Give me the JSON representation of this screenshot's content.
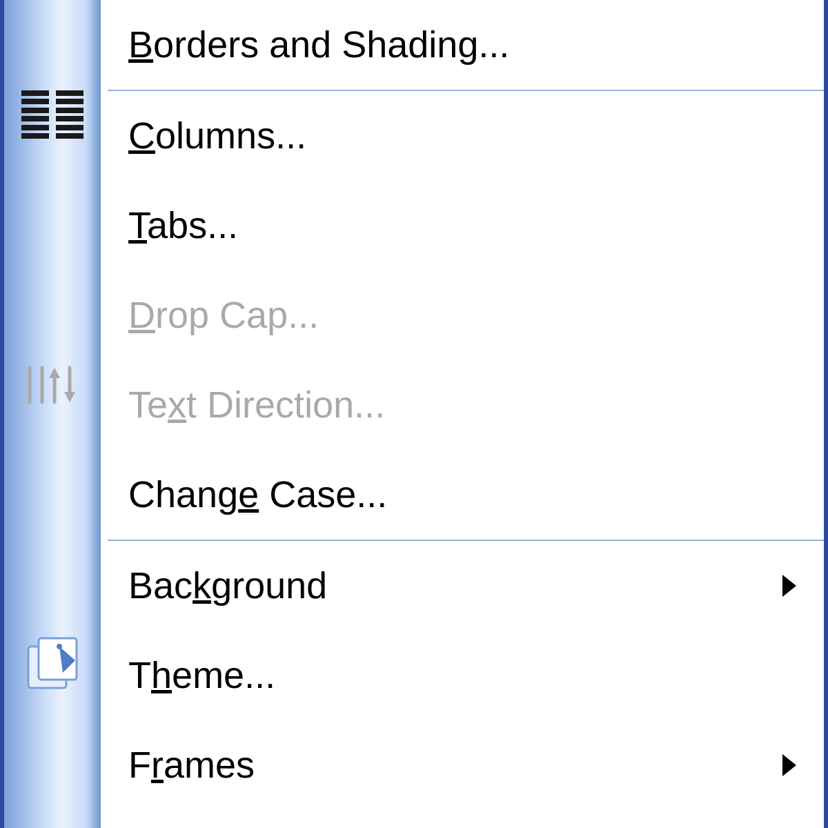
{
  "menu": {
    "items": [
      {
        "label_pre": "",
        "label_ul": "B",
        "label_post": "orders and Shading...",
        "disabled": false,
        "submenu": false,
        "icon": null,
        "sep_after": true
      },
      {
        "label_pre": "",
        "label_ul": "C",
        "label_post": "olumns...",
        "disabled": false,
        "submenu": false,
        "icon": "columns",
        "sep_after": false
      },
      {
        "label_pre": "",
        "label_ul": "T",
        "label_post": "abs...",
        "disabled": false,
        "submenu": false,
        "icon": null,
        "sep_after": false
      },
      {
        "label_pre": "",
        "label_ul": "D",
        "label_post": "rop Cap...",
        "disabled": true,
        "submenu": false,
        "icon": null,
        "sep_after": false
      },
      {
        "label_pre": "Te",
        "label_ul": "x",
        "label_post": "t Direction...",
        "disabled": true,
        "submenu": false,
        "icon": "textdir",
        "sep_after": false
      },
      {
        "label_pre": "Chang",
        "label_ul": "e",
        "label_post": " Case...",
        "disabled": false,
        "submenu": false,
        "icon": null,
        "sep_after": true
      },
      {
        "label_pre": "Bac",
        "label_ul": "k",
        "label_post": "ground",
        "disabled": false,
        "submenu": true,
        "icon": null,
        "sep_after": false
      },
      {
        "label_pre": "T",
        "label_ul": "h",
        "label_post": "eme...",
        "disabled": false,
        "submenu": false,
        "icon": "theme",
        "sep_after": false
      },
      {
        "label_pre": "F",
        "label_ul": "r",
        "label_post": "ames",
        "disabled": false,
        "submenu": true,
        "icon": null,
        "sep_after": false
      }
    ]
  }
}
